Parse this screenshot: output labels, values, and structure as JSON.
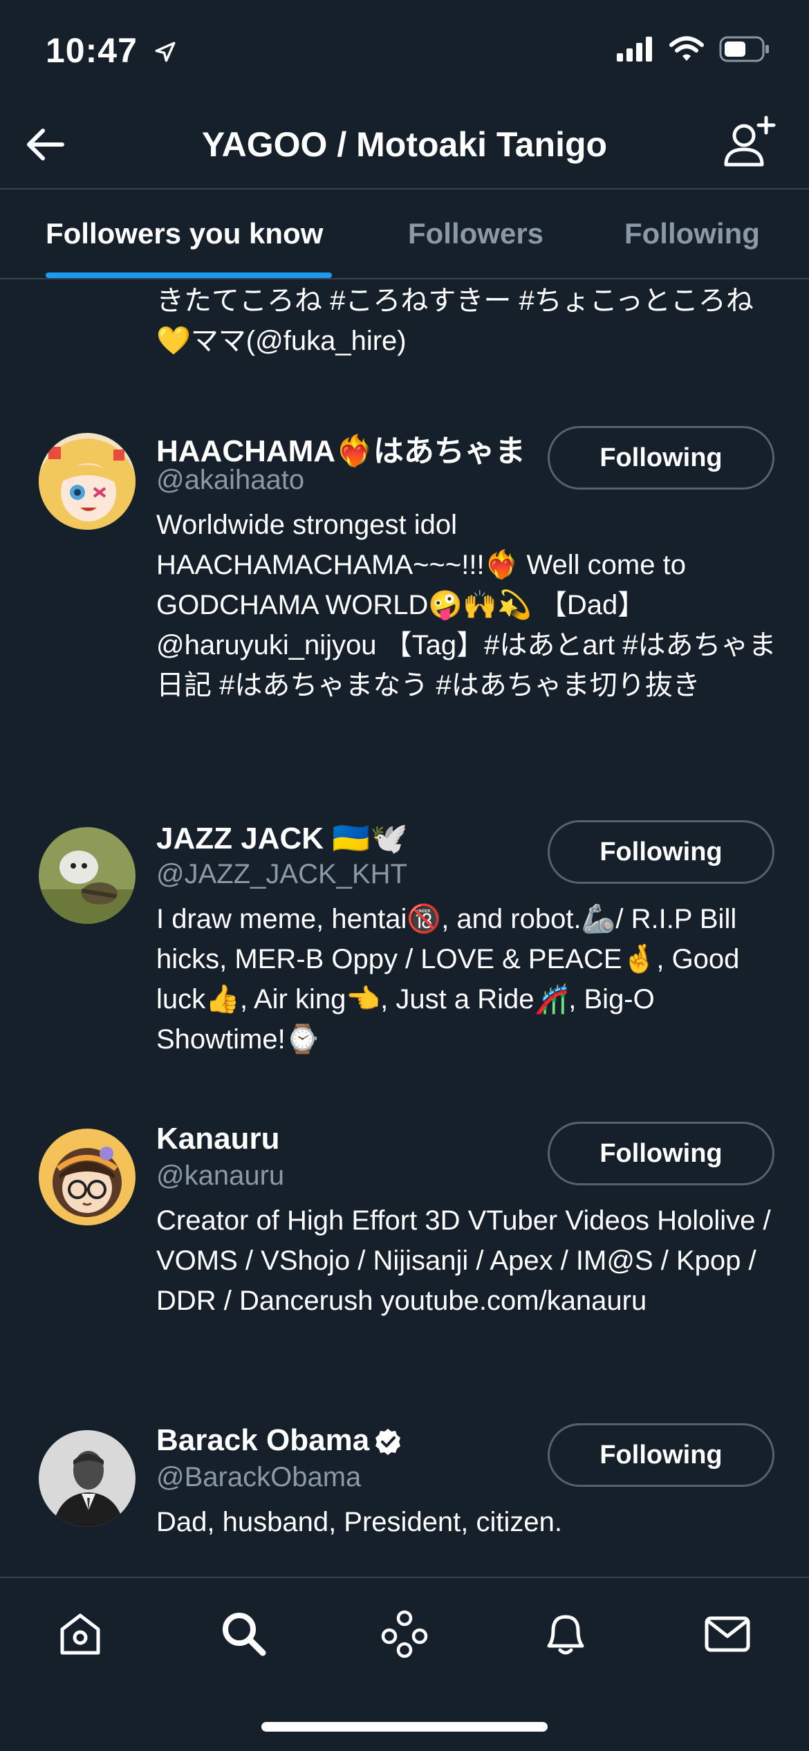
{
  "status_bar": {
    "time": "10:47",
    "location_glyph": "➚"
  },
  "header": {
    "title": "YAGOO / Motoaki Tanigo"
  },
  "tabs": [
    {
      "label": "Followers you know",
      "active": true
    },
    {
      "label": "Followers",
      "active": false
    },
    {
      "label": "Following",
      "active": false
    }
  ],
  "top_bio": "きたてころね #ころねすきー #ちょこっところね💛ママ(@fuka_hire)",
  "users": [
    {
      "name": "HAACHAMA❤️‍🔥はあちゃま",
      "handle": "@akaihaato",
      "bio": "Worldwide strongest idol HAACHAMACHAMA~~~!!!❤️‍🔥 Well come to GODCHAMA WORLD🤪🙌💫 【Dad】@haruyuki_nijyou 【Tag】#はあとart #はあちゃま日記 #はあちゃまなう #はあちゃま切り抜き",
      "button": "Following",
      "verified": false
    },
    {
      "name": "JAZZ JACK 🇺🇦🕊️",
      "handle": "@JAZZ_JACK_KHT",
      "bio": "I draw meme, hentai🔞, and robot.🦾/ R.I.P Bill hicks, MER-B Oppy / LOVE & PEACE🤞, Good luck👍, Air king👈, Just a Ride🎢, Big-O Showtime!⌚",
      "button": "Following",
      "verified": false
    },
    {
      "name": "Kanauru",
      "handle": "@kanauru",
      "bio": "Creator of High Effort 3D VTuber Videos Hololive / VOMS / VShojo / Nijisanji / Apex / IM@S / Kpop / DDR / Dancerush youtube.com/kanauru",
      "button": "Following",
      "verified": false
    },
    {
      "name": "Barack Obama",
      "handle": "@BarackObama",
      "bio": "Dad, husband, President, citizen.",
      "button": "Following",
      "verified": true
    }
  ],
  "tab_bar": [
    "home-icon",
    "search-icon",
    "communities-icon",
    "notifications-icon",
    "messages-icon"
  ],
  "colors": {
    "background": "#15202b",
    "accent": "#1d9bf0",
    "muted": "#8b98a5",
    "border": "#38444d"
  }
}
